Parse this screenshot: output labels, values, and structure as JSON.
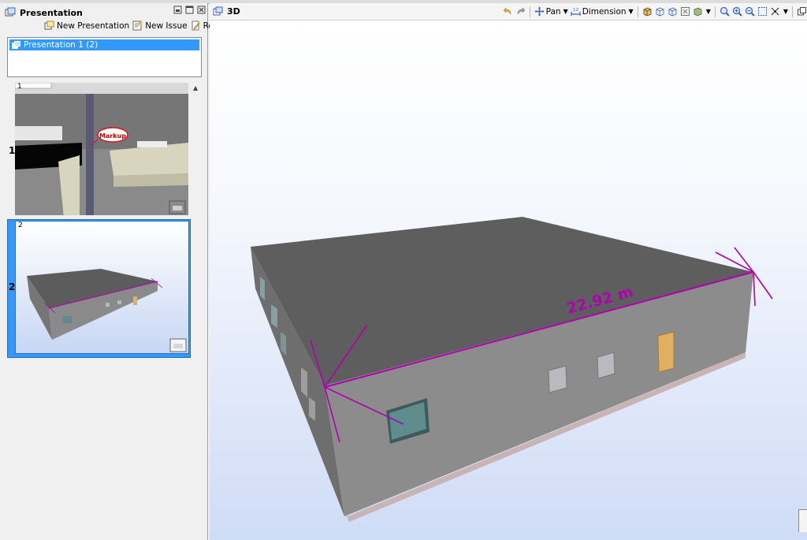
{
  "panel": {
    "title": "Presentation",
    "actions": {
      "new_presentation": "New Presentation",
      "new_issue": "New Issue",
      "report": "Report"
    },
    "presentation_item": "Presentation 1 (2)",
    "slides": [
      {
        "number": "1",
        "label": "1",
        "markup_text": "Markup"
      },
      {
        "number": "2",
        "label": "2"
      }
    ]
  },
  "view": {
    "title": "3D",
    "pan_label": "Pan",
    "dimension_label": "Dimension",
    "dimension_value": "22.92 m"
  },
  "colors": {
    "accent": "#3399ff",
    "dimension": "#b000b0",
    "roof": "#5c5c5c",
    "wall": "#8a8a8a",
    "door": "#e0b060"
  }
}
